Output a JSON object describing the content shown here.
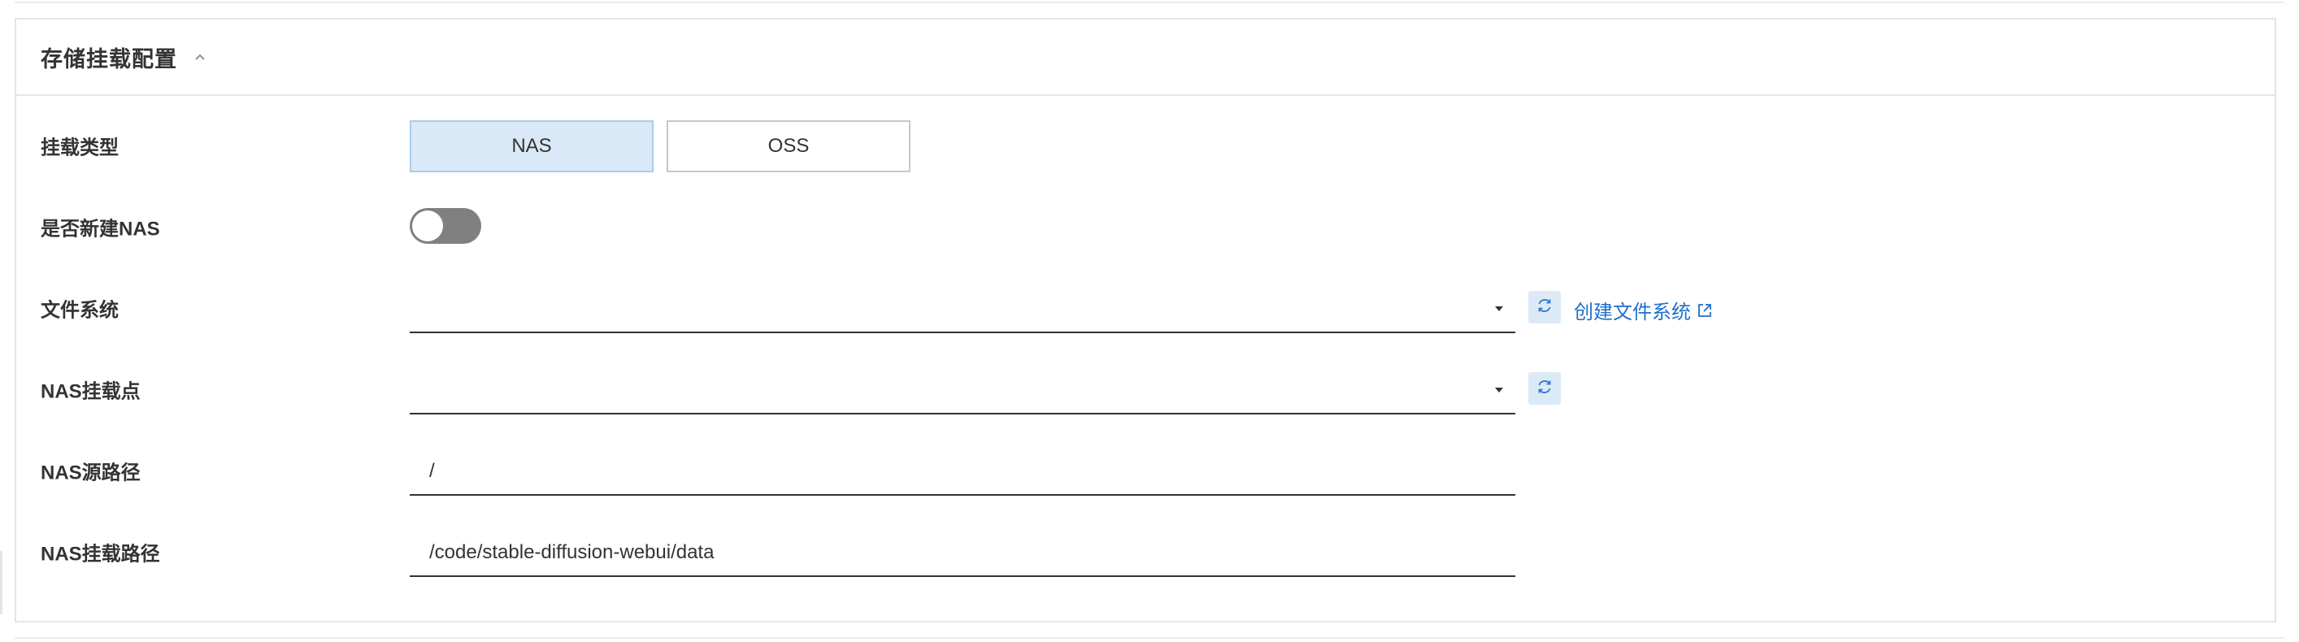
{
  "section": {
    "title": "存储挂载配置",
    "collapse_icon": "chevron-up-icon"
  },
  "form": {
    "mount_type": {
      "label": "挂载类型",
      "options": [
        "NAS",
        "OSS"
      ],
      "selected": "NAS"
    },
    "create_nas": {
      "label": "是否新建NAS",
      "checked": false
    },
    "file_system": {
      "label": "文件系统",
      "value": "",
      "refresh_icon": "refresh-icon",
      "create_link": "创建文件系统",
      "link_icon": "external-link-icon"
    },
    "mount_point": {
      "label": "NAS挂载点",
      "value": "",
      "refresh_icon": "refresh-icon"
    },
    "source_path": {
      "label": "NAS源路径",
      "value": "/"
    },
    "mount_path": {
      "label": "NAS挂载路径",
      "value": "/code/stable-diffusion-webui/data"
    }
  },
  "colors": {
    "accent": "#1f6fcc",
    "selected_bg": "#dae9f7",
    "toggle_off": "#808080"
  }
}
